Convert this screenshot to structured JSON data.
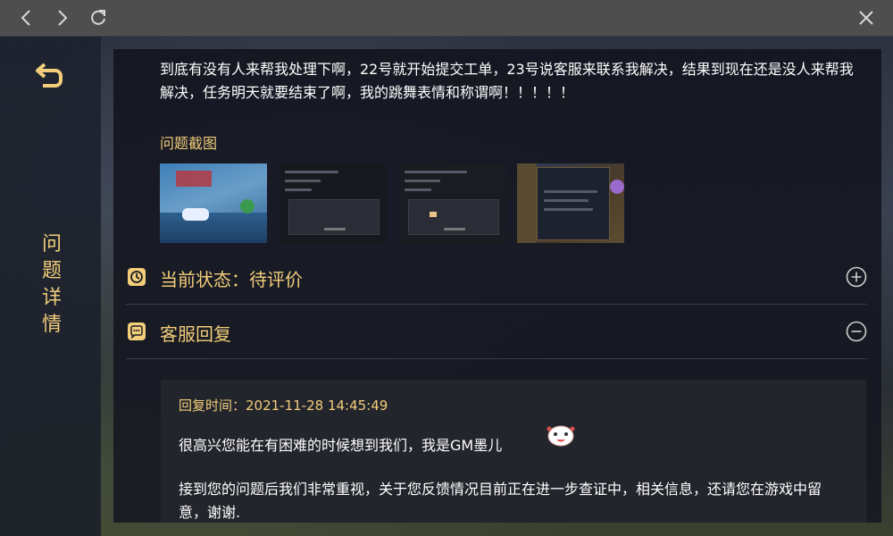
{
  "nav": {
    "back_icon": "chevron-left-icon",
    "forward_icon": "chevron-right-icon",
    "refresh_icon": "refresh-icon",
    "close_icon": "close-icon"
  },
  "sidebar": {
    "back_icon": "return-arrow-icon",
    "title_chars": [
      "问",
      "题",
      "详",
      "情"
    ]
  },
  "ticket": {
    "description": "到底有没有人来帮我处理下啊，22号就开始提交工单，23号说客服来联系我解决，结果到现在还是没人来帮我解决，任务明天就要结束了啊，我的跳舞表情和称谓啊！！！！！",
    "screenshots_label": "问题截图"
  },
  "status": {
    "label": "当前状态：待评价",
    "icon": "clock-icon",
    "toggle_icon": "plus-circle-icon"
  },
  "support": {
    "label": "客服回复",
    "icon": "chat-bubble-icon",
    "toggle_icon": "minus-circle-icon",
    "reply_time": "回复时间：2021-11-28 14:45:49",
    "reply_p1": "很高兴您能在有困难的时候想到我们，我是GM墨儿",
    "reply_p2": "接到您的问题后我们非常重视，关于您反馈情况目前正在进一步查证中，相关信息，还请您在游戏中留意，谢谢."
  },
  "colors": {
    "accent": "#f2cd7a",
    "topbar": "#4e4e4e",
    "panel": "#14161f",
    "reply_bg": "#23252c"
  }
}
